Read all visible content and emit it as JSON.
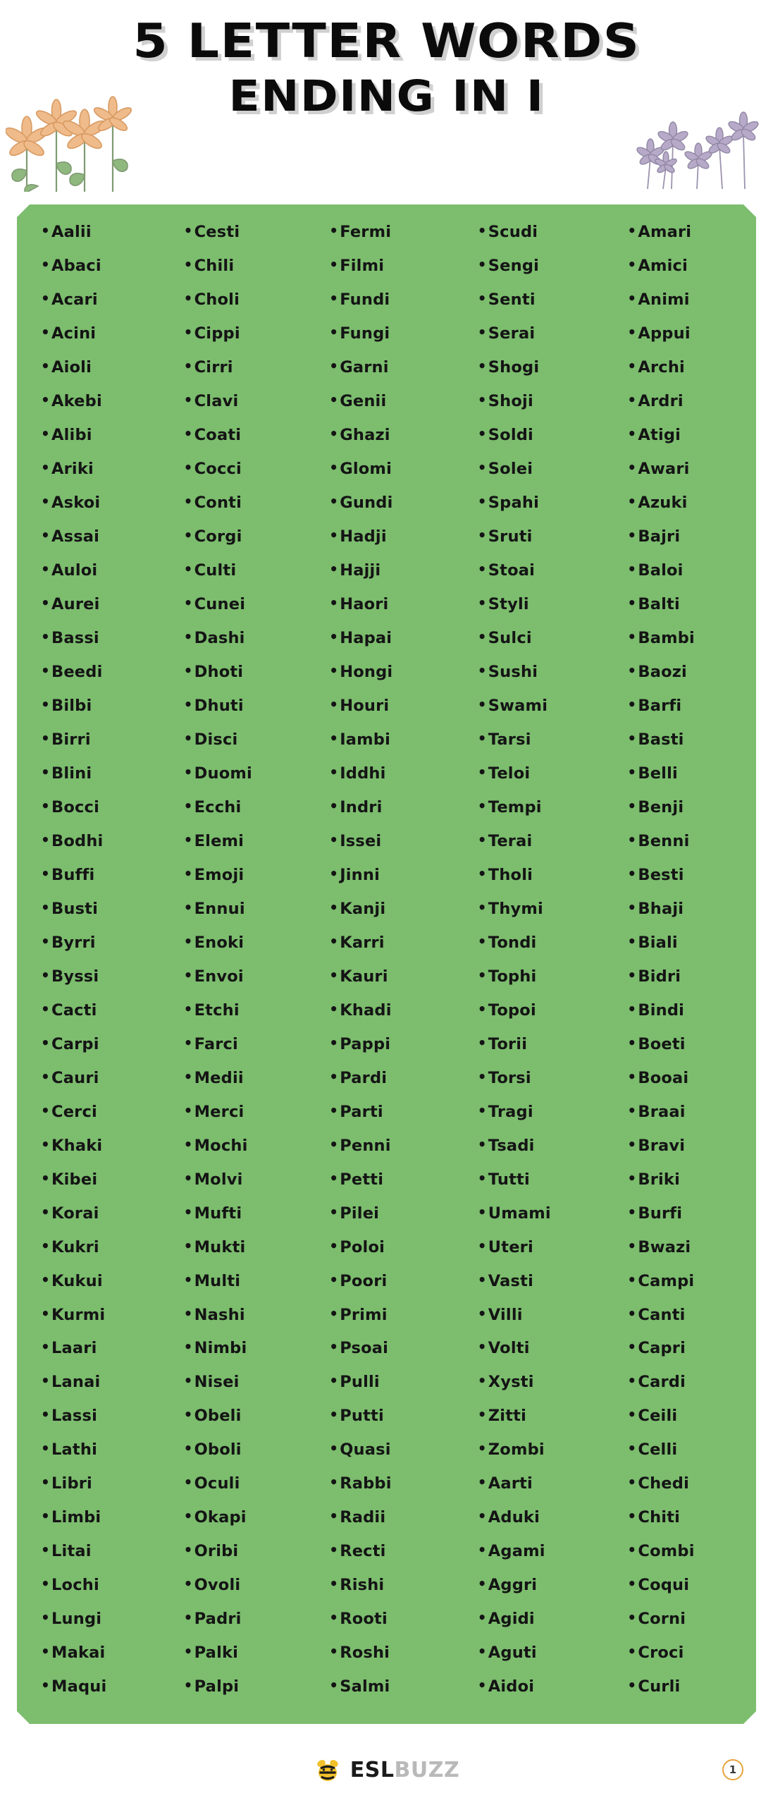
{
  "header": {
    "title_line1": "5 LETTER WORDS",
    "title_line2": "ENDING IN I"
  },
  "footer": {
    "brand_primary": "ESL",
    "brand_secondary": "BUZZ",
    "page_number": "1"
  },
  "columns": [
    {
      "id": "column-1",
      "words": [
        "Aalii",
        "Abaci",
        "Acari",
        "Acini",
        "Aioli",
        "Akebi",
        "Alibi",
        "Ariki",
        "Askoi",
        "Assai",
        "Auloi",
        "Aurei",
        "Bassi",
        "Beedi",
        "Bilbi",
        "Birri",
        "Blini",
        "Bocci",
        "Bodhi",
        "Buffi",
        "Busti",
        "Byrri",
        "Byssi",
        "Cacti",
        "Carpi",
        "Cauri",
        "Cerci",
        "Khaki",
        "Kibei",
        "Korai",
        "Kukri",
        "Kukui",
        "Kurmi",
        "Laari",
        "Lanai",
        "Lassi",
        "Lathi",
        "Libri",
        "Limbi",
        "Litai",
        "Lochi",
        "Lungi",
        "Makai",
        "Maqui"
      ]
    },
    {
      "id": "column-2",
      "words": [
        "Cesti",
        "Chili",
        "Choli",
        "Cippi",
        "Cirri",
        "Clavi",
        "Coati",
        "Cocci",
        "Conti",
        "Corgi",
        "Culti",
        "Cunei",
        "Dashi",
        "Dhoti",
        "Dhuti",
        "Disci",
        "Duomi",
        "Ecchi",
        "Elemi",
        "Emoji",
        "Ennui",
        "Enoki",
        "Envoi",
        "Etchi",
        "Farci",
        "Medii",
        "Merci",
        "Mochi",
        "Molvi",
        "Mufti",
        "Mukti",
        "Multi",
        "Nashi",
        "Nimbi",
        "Nisei",
        "Obeli",
        "Oboli",
        "Oculi",
        "Okapi",
        "Oribi",
        "Ovoli",
        "Padri",
        "Palki",
        "Palpi"
      ]
    },
    {
      "id": "column-3",
      "words": [
        "Fermi",
        "Filmi",
        "Fundi",
        "Fungi",
        "Garni",
        "Genii",
        "Ghazi",
        "Glomi",
        "Gundi",
        "Hadji",
        "Hajji",
        "Haori",
        "Hapai",
        "Hongi",
        "Houri",
        "Iambi",
        "Iddhi",
        "Indri",
        "Issei",
        "Jinni",
        "Kanji",
        "Karri",
        "Kauri",
        "Khadi",
        "Pappi",
        "Pardi",
        "Parti",
        "Penni",
        "Petti",
        "Pilei",
        "Poloi",
        "Poori",
        "Primi",
        "Psoai",
        "Pulli",
        "Putti",
        "Quasi",
        "Rabbi",
        "Radii",
        "Recti",
        "Rishi",
        "Rooti",
        "Roshi",
        "Salmi"
      ]
    },
    {
      "id": "column-4",
      "words": [
        "Scudi",
        "Sengi",
        "Senti",
        "Serai",
        "Shogi",
        "Shoji",
        "Soldi",
        "Solei",
        "Spahi",
        "Sruti",
        "Stoai",
        "Styli",
        "Sulci",
        "Sushi",
        "Swami",
        "Tarsi",
        "Teloi",
        "Tempi",
        "Terai",
        "Tholi",
        "Thymi",
        "Tondi",
        "Tophi",
        "Topoi",
        "Torii",
        "Torsi",
        "Tragi",
        "Tsadi",
        "Tutti",
        "Umami",
        "Uteri",
        "Vasti",
        "Villi",
        "Volti",
        "Xysti",
        "Zitti",
        "Zombi",
        "Aarti",
        "Aduki",
        "Agami",
        "Aggri",
        "Agidi",
        "Aguti",
        "Aidoi"
      ]
    },
    {
      "id": "column-5",
      "words": [
        "Amari",
        "Amici",
        "Animi",
        "Appui",
        "Archi",
        "Ardri",
        "Atigi",
        "Awari",
        "Azuki",
        "Bajri",
        "Baloi",
        "Balti",
        "Bambi",
        "Baozi",
        "Barfi",
        "Basti",
        "Belli",
        "Benji",
        "Benni",
        "Besti",
        "Bhaji",
        "Biali",
        "Bidri",
        "Bindi",
        "Boeti",
        "Booai",
        "Braai",
        "Bravi",
        "Briki",
        "Burfi",
        "Bwazi",
        "Campi",
        "Canti",
        "Capri",
        "Cardi",
        "Ceili",
        "Celli",
        "Chedi",
        "Chiti",
        "Combi",
        "Coqui",
        "Corni",
        "Croci",
        "Curli"
      ]
    }
  ],
  "colors": {
    "panel_green": "#7cbd6e",
    "title_black": "#0b0b0b",
    "flower_orange": "#f0bb8a",
    "flower_purple": "#b6aac8",
    "leaf_green": "#8fb87f",
    "badge_orange": "#e8a33d",
    "bee_yellow": "#f2c029"
  },
  "icons": {
    "bullet": "•",
    "bee": "bee-icon",
    "flower_left": "lily-flowers-icon",
    "flower_right": "violet-flowers-icon"
  }
}
